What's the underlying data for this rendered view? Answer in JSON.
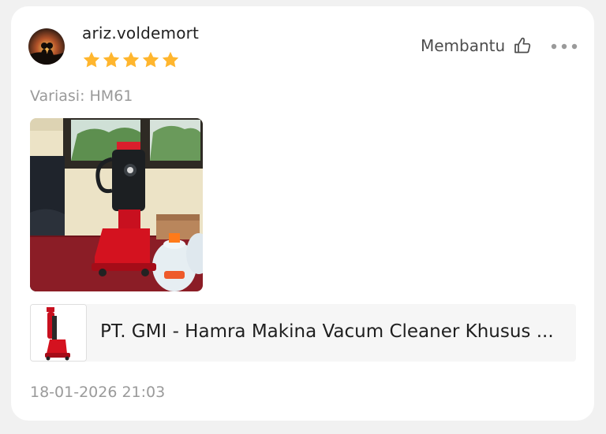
{
  "review": {
    "username": "ariz.voldemort",
    "rating": 5,
    "rating_max": 5,
    "rating_color": "#ffb62e",
    "helpful_label": "Membantu",
    "helpful_icon": "thumbs-up-icon",
    "more_icon": "more-options-icon",
    "variation": "Variasi: HM61",
    "photo_icon": "review-photo",
    "product": {
      "name": "PT. GMI - Hamra Makina Vacum Cleaner Khusus ...",
      "thumb_icon": "product-thumbnail"
    },
    "timestamp": "18-01-2026 21:03"
  }
}
